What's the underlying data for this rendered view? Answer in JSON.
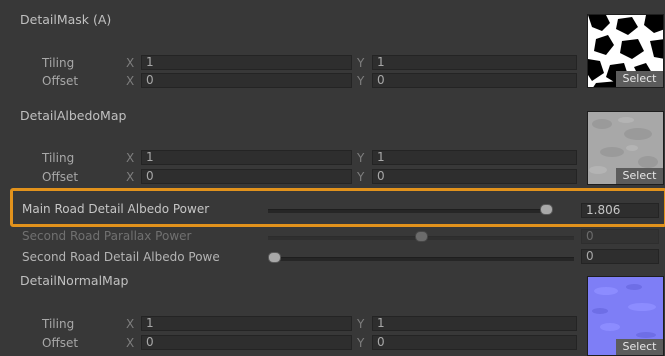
{
  "detail_mask": {
    "title": "DetailMask (A)",
    "tiling_label": "Tiling",
    "offset_label": "Offset",
    "x_axis": "X",
    "y_axis": "Y",
    "tiling_x": "1",
    "tiling_y": "1",
    "offset_x": "0",
    "offset_y": "0",
    "select_label": "Select"
  },
  "detail_albedo": {
    "title": "DetailAlbedoMap",
    "tiling_label": "Tiling",
    "offset_label": "Offset",
    "x_axis": "X",
    "y_axis": "Y",
    "tiling_x": "1",
    "tiling_y": "1",
    "offset_x": "0",
    "offset_y": "0",
    "select_label": "Select"
  },
  "sliders": [
    {
      "label": "Main Road Detail Albedo Power",
      "value": "1.806",
      "fraction": 0.98,
      "highlighted": true,
      "disabled": false
    },
    {
      "label": "Second Road Parallax Power",
      "value": "0",
      "fraction": 0.5,
      "highlighted": false,
      "disabled": true
    },
    {
      "label": "Second Road Detail Albedo Powe",
      "value": "0",
      "fraction": 0.0,
      "highlighted": false,
      "disabled": false
    }
  ],
  "detail_normal": {
    "title": "DetailNormalMap",
    "tiling_label": "Tiling",
    "offset_label": "Offset",
    "x_axis": "X",
    "y_axis": "Y",
    "tiling_x": "1",
    "tiling_y": "1",
    "offset_x": "0",
    "offset_y": "0",
    "select_label": "Select"
  },
  "colors": {
    "highlight": "#e1921c",
    "panel_bg": "#383838"
  }
}
